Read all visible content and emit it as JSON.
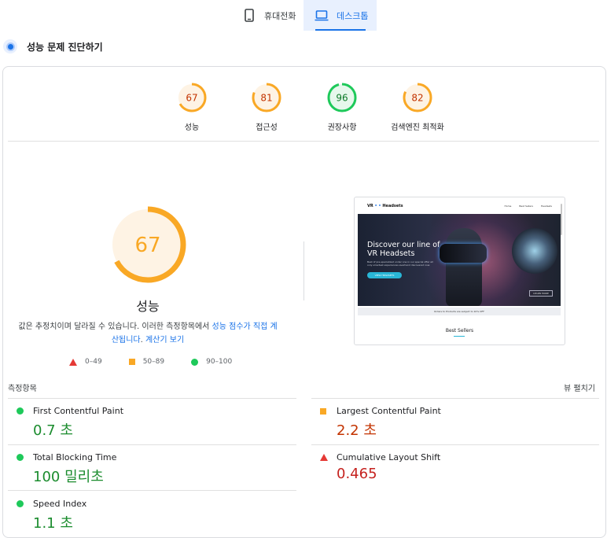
{
  "tabs": {
    "mobile": {
      "label": "휴대전화",
      "icon": "smartphone-icon"
    },
    "desktop": {
      "label": "데스크톱",
      "icon": "laptop-icon",
      "selected": true
    }
  },
  "section": {
    "title": "성능 문제 진단하기",
    "icon": "diagnose-icon"
  },
  "categories": [
    {
      "score": "67",
      "label": "성능",
      "fraction": 0.67,
      "color": "#f9a825"
    },
    {
      "score": "81",
      "label": "접근성",
      "fraction": 0.81,
      "color": "#f9a825"
    },
    {
      "score": "96",
      "label": "권장사항",
      "fraction": 0.96,
      "color": "#1ec95a"
    },
    {
      "score": "82",
      "label": "검색엔진 최적화",
      "fraction": 0.82,
      "color": "#f9a825"
    }
  ],
  "performance": {
    "score": "67",
    "fraction": 0.67,
    "title": "성능",
    "desc_text": "값은 추정치이며 달라질 수 있습니다. 이러한 측정항목에서 ",
    "desc_link1": "성능 점수가 직접 계산됩니다",
    "desc_sep": ". ",
    "desc_link2": "계산기 보기",
    "legend": [
      {
        "range": "0–49",
        "shape": "triangle-red"
      },
      {
        "range": "50–89",
        "shape": "square-orange"
      },
      {
        "range": "90–100",
        "shape": "circle-green"
      }
    ]
  },
  "preview": {
    "logo_prefix": "VR",
    "logo_suffix": "Headsets",
    "nav": [
      "Home",
      "Best Sellers",
      "Headsets"
    ],
    "hero_title_1": "Discover our line of",
    "hero_title_2": "VR Headsets",
    "hero_text": "Best of pre-specialized under one in our special offer all only smartest experiences everhand discovered now.",
    "hero_button": "VIEW HEADSETS",
    "hero_badge": "LEARN MORE",
    "strip_text": "Orders to Products are subject to 10% OFF",
    "best_sellers": "Best Sellers"
  },
  "metrics": {
    "header": "측정항목",
    "expand": "뷰 펼치기",
    "items": [
      {
        "name": "First Contentful Paint",
        "value": "0.7 초",
        "status": "good"
      },
      {
        "name": "Largest Contentful Paint",
        "value": "2.2 초",
        "status": "average"
      },
      {
        "name": "Total Blocking Time",
        "value": "100 밀리초",
        "status": "good"
      },
      {
        "name": "Cumulative Layout Shift",
        "value": "0.465",
        "status": "poor"
      },
      {
        "name": "Speed Index",
        "value": "1.1 초",
        "status": "good"
      }
    ]
  }
}
